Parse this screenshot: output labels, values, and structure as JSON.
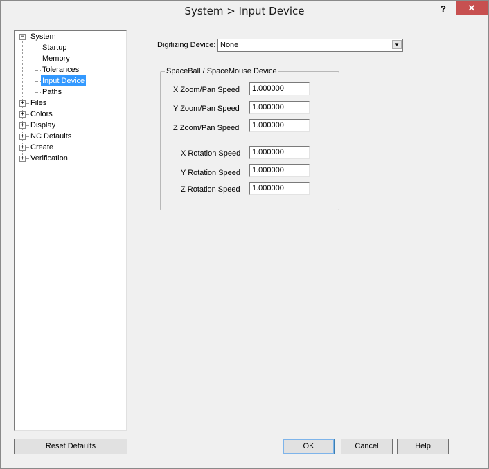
{
  "window": {
    "title": "System > Input Device",
    "help_label": "?",
    "close_label": "✕"
  },
  "tree": {
    "items": [
      {
        "label": "System",
        "expander": "−"
      },
      {
        "label": "Startup"
      },
      {
        "label": "Memory"
      },
      {
        "label": "Tolerances"
      },
      {
        "label": "Input Device",
        "selected": true
      },
      {
        "label": "Paths"
      },
      {
        "label": "Files",
        "expander": "+"
      },
      {
        "label": "Colors",
        "expander": "+"
      },
      {
        "label": "Display",
        "expander": "+"
      },
      {
        "label": "NC Defaults",
        "expander": "+"
      },
      {
        "label": "Create",
        "expander": "+"
      },
      {
        "label": "Verification",
        "expander": "+"
      }
    ]
  },
  "digitizing": {
    "label": "Digitizing Device:",
    "value": "None",
    "arrow_icon": "▼"
  },
  "spaceball": {
    "title": "SpaceBall / SpaceMouse Device",
    "fields": [
      {
        "label": "X Zoom/Pan Speed",
        "value": "1.000000"
      },
      {
        "label": "Y Zoom/Pan Speed",
        "value": "1.000000"
      },
      {
        "label": "Z Zoom/Pan Speed",
        "value": "1.000000"
      },
      {
        "label": "X Rotation Speed",
        "value": "1.000000"
      },
      {
        "label": "Y Rotation Speed",
        "value": "1.000000"
      },
      {
        "label": "Z Rotation Speed",
        "value": "1.000000"
      }
    ]
  },
  "buttons": {
    "reset": "Reset Defaults",
    "ok": "OK",
    "cancel": "Cancel",
    "help": "Help"
  },
  "colors": {
    "selection": "#3399ff",
    "close": "#c75050"
  }
}
